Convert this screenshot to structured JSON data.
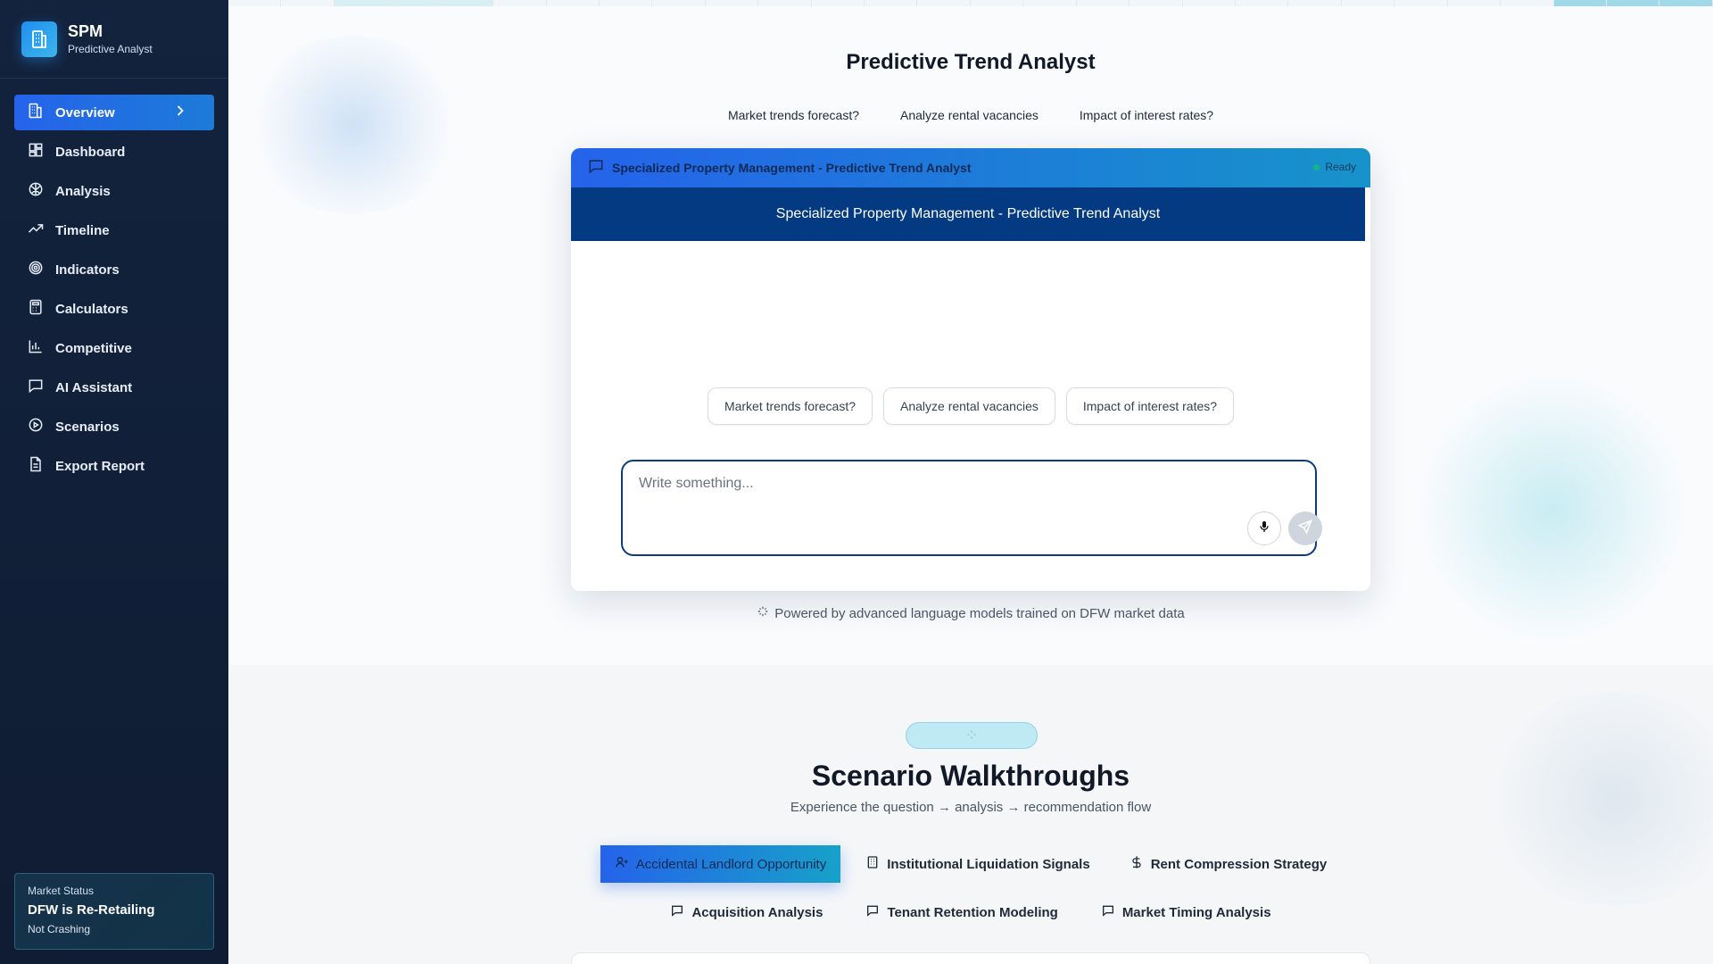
{
  "brand": {
    "title": "SPM",
    "subtitle": "Predictive Analyst"
  },
  "sidebar": {
    "items": [
      {
        "label": "Overview",
        "icon": "building-icon",
        "active": true
      },
      {
        "label": "Dashboard",
        "icon": "grid-icon"
      },
      {
        "label": "Analysis",
        "icon": "brain-icon"
      },
      {
        "label": "Timeline",
        "icon": "trend-up-icon"
      },
      {
        "label": "Indicators",
        "icon": "target-icon"
      },
      {
        "label": "Calculators",
        "icon": "calculator-icon"
      },
      {
        "label": "Competitive",
        "icon": "bar-chart-icon"
      },
      {
        "label": "AI Assistant",
        "icon": "chat-icon"
      },
      {
        "label": "Scenarios",
        "icon": "play-icon"
      },
      {
        "label": "Export Report",
        "icon": "document-icon"
      }
    ],
    "market": {
      "label": "Market Status",
      "value": "DFW is Re-Retailing",
      "sub": "Not Crashing"
    }
  },
  "hero": {
    "title": "Predictive Trend Analyst",
    "links": [
      "Market trends forecast?",
      "Analyze rental vacancies",
      "Impact of interest rates?"
    ]
  },
  "chat": {
    "header_title": "Specialized Property Management - Predictive Trend Analyst",
    "status": "Ready",
    "banner": "Specialized Property Management - Predictive Trend Analyst",
    "chips": [
      "Market trends forecast?",
      "Analyze rental vacancies",
      "Impact of interest rates?"
    ],
    "input_placeholder": "Write something...",
    "powered_by": "Powered by advanced language models trained on DFW market data"
  },
  "scenarios": {
    "title": "Scenario Walkthroughs",
    "subtitle": "Experience the question → analysis → recommendation flow",
    "tabs_row1": [
      {
        "label": "Accidental Landlord Opportunity",
        "icon": "user-plus-icon",
        "active": true
      },
      {
        "label": "Institutional Liquidation Signals",
        "icon": "building-icon"
      },
      {
        "label": "Rent Compression Strategy",
        "icon": "dollar-icon"
      }
    ],
    "tabs_row2": [
      {
        "label": "Acquisition Analysis",
        "icon": "chat-icon"
      },
      {
        "label": "Tenant Retention Modeling",
        "icon": "chat-icon"
      },
      {
        "label": "Market Timing Analysis",
        "icon": "chat-icon"
      }
    ]
  },
  "colors": {
    "sidebar_bg": "#13233d",
    "accent": "#2563eb",
    "banner": "#043a82",
    "status_green": "#10b981"
  }
}
